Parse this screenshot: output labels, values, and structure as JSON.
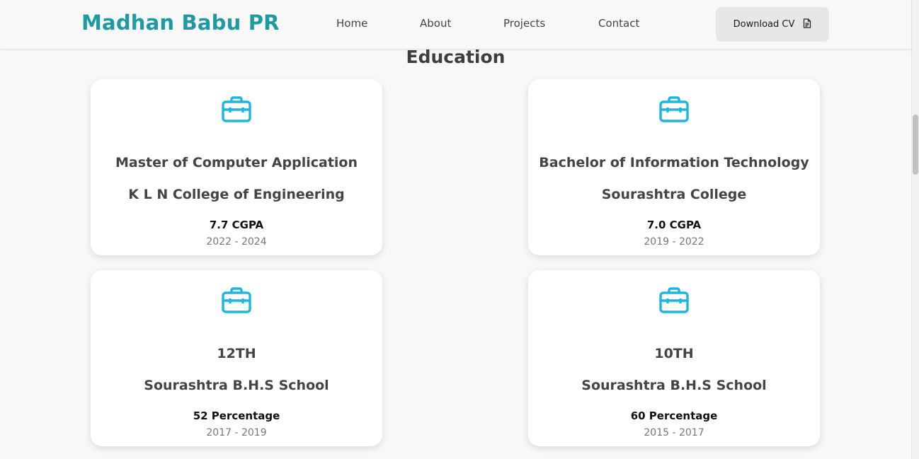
{
  "header": {
    "brand": "Madhan Babu PR",
    "nav": [
      "Home",
      "About",
      "Projects",
      "Contact"
    ],
    "cv_button": "Download CV",
    "cv_icon": "file-document-icon"
  },
  "section": {
    "title": "Education"
  },
  "colors": {
    "brand": "#1f9aa3",
    "icon": "#1ab7e0",
    "button_bg": "#e7e7e7"
  },
  "education": [
    {
      "icon": "briefcase-icon",
      "degree": "Master of Computer Application",
      "institution": "K L N College of Engineering",
      "score": "7.7 CGPA",
      "years": "2022 - 2024"
    },
    {
      "icon": "briefcase-icon",
      "degree": "Bachelor of Information Technology",
      "institution": "Sourashtra College",
      "score": "7.0 CGPA",
      "years": "2019 - 2022"
    },
    {
      "icon": "briefcase-icon",
      "degree": "12TH",
      "institution": "Sourashtra B.H.S School",
      "score": "52 Percentage",
      "years": "2017 - 2019"
    },
    {
      "icon": "briefcase-icon",
      "degree": "10TH",
      "institution": "Sourashtra B.H.S School",
      "score": "60 Percentage",
      "years": "2015 - 2017"
    }
  ]
}
